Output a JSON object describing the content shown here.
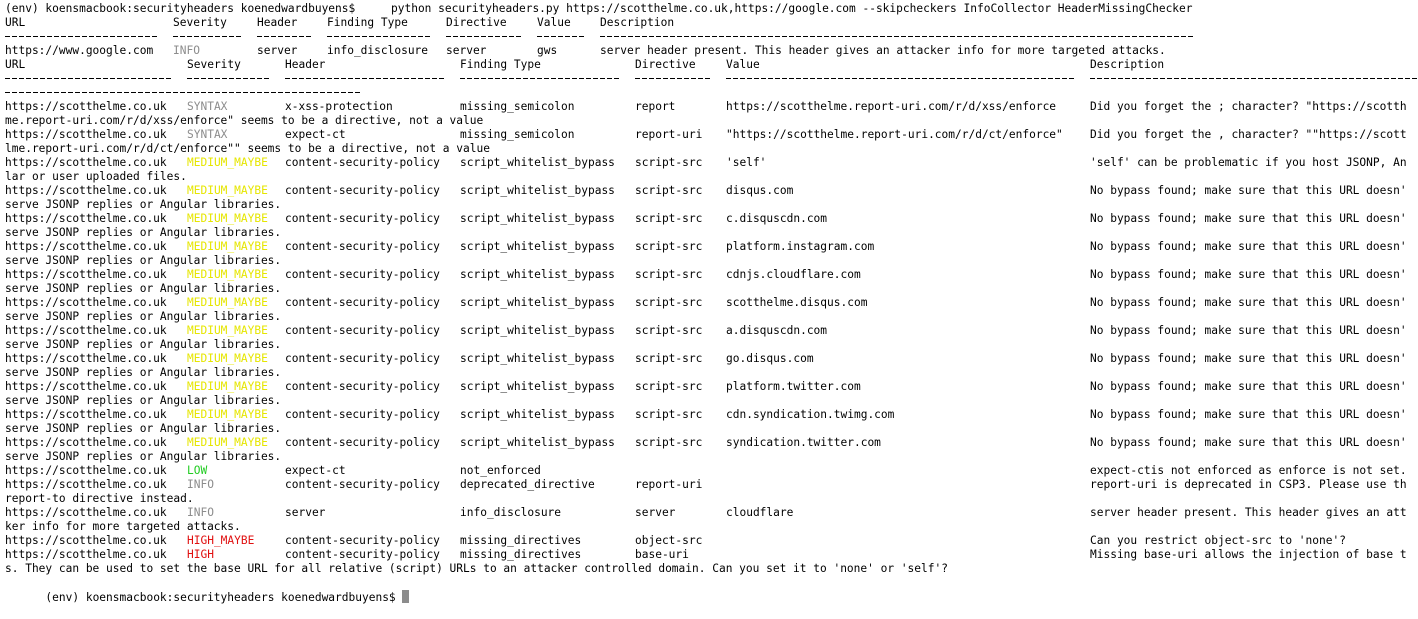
{
  "terminal": {
    "prompt": "(env) koensmacbook:securityheaders koenedwardbuyens$",
    "command": "python securityheaders.py https://scotthelme.co.uk,https://google.com --skipcheckers InfoCollector HeaderMissingChecker",
    "colors": {
      "INFO": "#8c8c8c",
      "SYNTAX": "#8c8c8c",
      "MEDIUM_MAYBE": "#e6e600",
      "LOW": "#22cc22",
      "HIGH_MAYBE": "#e01010",
      "HIGH": "#e01010"
    }
  },
  "columns": {
    "url": "URL",
    "severity": "Severity",
    "header": "Header",
    "finding_type": "Finding Type",
    "directive": "Directive",
    "value": "Value",
    "description": "Description"
  },
  "table1": {
    "rows": [
      {
        "url": "https://www.google.com",
        "severity": "INFO",
        "header": "server",
        "finding_type": "info_disclosure",
        "directive": "server",
        "value": "gws",
        "description": "server header present. This header gives an attacker info for more targeted attacks."
      }
    ]
  },
  "table2": {
    "rows": [
      {
        "url": "https://scotthelme.co.uk",
        "severity": "SYNTAX",
        "header": "x-xss-protection",
        "finding_type": "missing_semicolon",
        "directive": "report",
        "value": "https://scotthelme.report-uri.com/r/d/xss/enforce",
        "description": "Did you forget the ; character? \"https://scotth",
        "wrap": "me.report-uri.com/r/d/xss/enforce\" seems to be a directive, not a value"
      },
      {
        "url": "https://scotthelme.co.uk",
        "severity": "SYNTAX",
        "header": "expect-ct",
        "finding_type": "missing_semicolon",
        "directive": "report-uri",
        "value": "\"https://scotthelme.report-uri.com/r/d/ct/enforce\"",
        "description": "Did you forget the , character? \"\"https://scott",
        "wrap": "lme.report-uri.com/r/d/ct/enforce\"\" seems to be a directive, not a value"
      },
      {
        "url": "https://scotthelme.co.uk",
        "severity": "MEDIUM_MAYBE",
        "header": "content-security-policy",
        "finding_type": "script_whitelist_bypass",
        "directive": "script-src",
        "value": "'self'",
        "description": "'self' can be problematic if you host JSONP, An",
        "wrap": "lar or user uploaded files."
      },
      {
        "url": "https://scotthelme.co.uk",
        "severity": "MEDIUM_MAYBE",
        "header": "content-security-policy",
        "finding_type": "script_whitelist_bypass",
        "directive": "script-src",
        "value": "disqus.com",
        "description": "No bypass found; make sure that this URL doesn'",
        "wrap": "serve JSONP replies or Angular libraries."
      },
      {
        "url": "https://scotthelme.co.uk",
        "severity": "MEDIUM_MAYBE",
        "header": "content-security-policy",
        "finding_type": "script_whitelist_bypass",
        "directive": "script-src",
        "value": "c.disquscdn.com",
        "description": "No bypass found; make sure that this URL doesn'",
        "wrap": "serve JSONP replies or Angular libraries."
      },
      {
        "url": "https://scotthelme.co.uk",
        "severity": "MEDIUM_MAYBE",
        "header": "content-security-policy",
        "finding_type": "script_whitelist_bypass",
        "directive": "script-src",
        "value": "platform.instagram.com",
        "description": "No bypass found; make sure that this URL doesn'",
        "wrap": "serve JSONP replies or Angular libraries."
      },
      {
        "url": "https://scotthelme.co.uk",
        "severity": "MEDIUM_MAYBE",
        "header": "content-security-policy",
        "finding_type": "script_whitelist_bypass",
        "directive": "script-src",
        "value": "cdnjs.cloudflare.com",
        "description": "No bypass found; make sure that this URL doesn'",
        "wrap": "serve JSONP replies or Angular libraries."
      },
      {
        "url": "https://scotthelme.co.uk",
        "severity": "MEDIUM_MAYBE",
        "header": "content-security-policy",
        "finding_type": "script_whitelist_bypass",
        "directive": "script-src",
        "value": "scotthelme.disqus.com",
        "description": "No bypass found; make sure that this URL doesn'",
        "wrap": "serve JSONP replies or Angular libraries."
      },
      {
        "url": "https://scotthelme.co.uk",
        "severity": "MEDIUM_MAYBE",
        "header": "content-security-policy",
        "finding_type": "script_whitelist_bypass",
        "directive": "script-src",
        "value": "a.disquscdn.com",
        "description": "No bypass found; make sure that this URL doesn'",
        "wrap": "serve JSONP replies or Angular libraries."
      },
      {
        "url": "https://scotthelme.co.uk",
        "severity": "MEDIUM_MAYBE",
        "header": "content-security-policy",
        "finding_type": "script_whitelist_bypass",
        "directive": "script-src",
        "value": "go.disqus.com",
        "description": "No bypass found; make sure that this URL doesn'",
        "wrap": "serve JSONP replies or Angular libraries."
      },
      {
        "url": "https://scotthelme.co.uk",
        "severity": "MEDIUM_MAYBE",
        "header": "content-security-policy",
        "finding_type": "script_whitelist_bypass",
        "directive": "script-src",
        "value": "platform.twitter.com",
        "description": "No bypass found; make sure that this URL doesn'",
        "wrap": "serve JSONP replies or Angular libraries."
      },
      {
        "url": "https://scotthelme.co.uk",
        "severity": "MEDIUM_MAYBE",
        "header": "content-security-policy",
        "finding_type": "script_whitelist_bypass",
        "directive": "script-src",
        "value": "cdn.syndication.twimg.com",
        "description": "No bypass found; make sure that this URL doesn'",
        "wrap": "serve JSONP replies or Angular libraries."
      },
      {
        "url": "https://scotthelme.co.uk",
        "severity": "MEDIUM_MAYBE",
        "header": "content-security-policy",
        "finding_type": "script_whitelist_bypass",
        "directive": "script-src",
        "value": "syndication.twitter.com",
        "description": "No bypass found; make sure that this URL doesn'",
        "wrap": "serve JSONP replies or Angular libraries."
      },
      {
        "url": "https://scotthelme.co.uk",
        "severity": "LOW",
        "header": "expect-ct",
        "finding_type": "not_enforced",
        "directive": "",
        "value": "",
        "description": "expect-ctis not enforced as enforce is not set.",
        "wrap": null
      },
      {
        "url": "https://scotthelme.co.uk",
        "severity": "INFO",
        "header": "content-security-policy",
        "finding_type": "deprecated_directive",
        "directive": "report-uri",
        "value": "",
        "description": "report-uri is deprecated in CSP3. Please use th",
        "wrap": "report-to directive instead."
      },
      {
        "url": "https://scotthelme.co.uk",
        "severity": "INFO",
        "header": "server",
        "finding_type": "info_disclosure",
        "directive": "server",
        "value": "cloudflare",
        "description": "server header present. This header gives an att",
        "wrap": "ker info for more targeted attacks."
      },
      {
        "url": "https://scotthelme.co.uk",
        "severity": "HIGH_MAYBE",
        "header": "content-security-policy",
        "finding_type": "missing_directives",
        "directive": "object-src",
        "value": "",
        "description": "Can you restrict object-src to 'none'?",
        "wrap": null
      },
      {
        "url": "https://scotthelme.co.uk",
        "severity": "HIGH",
        "header": "content-security-policy",
        "finding_type": "missing_directives",
        "directive": "base-uri",
        "value": "",
        "description": "Missing base-uri allows the injection of base t",
        "wrap": "s. They can be used to set the base URL for all relative (script) URLs to an attacker controlled domain. Can you set it to 'none' or 'self'?"
      }
    ]
  }
}
